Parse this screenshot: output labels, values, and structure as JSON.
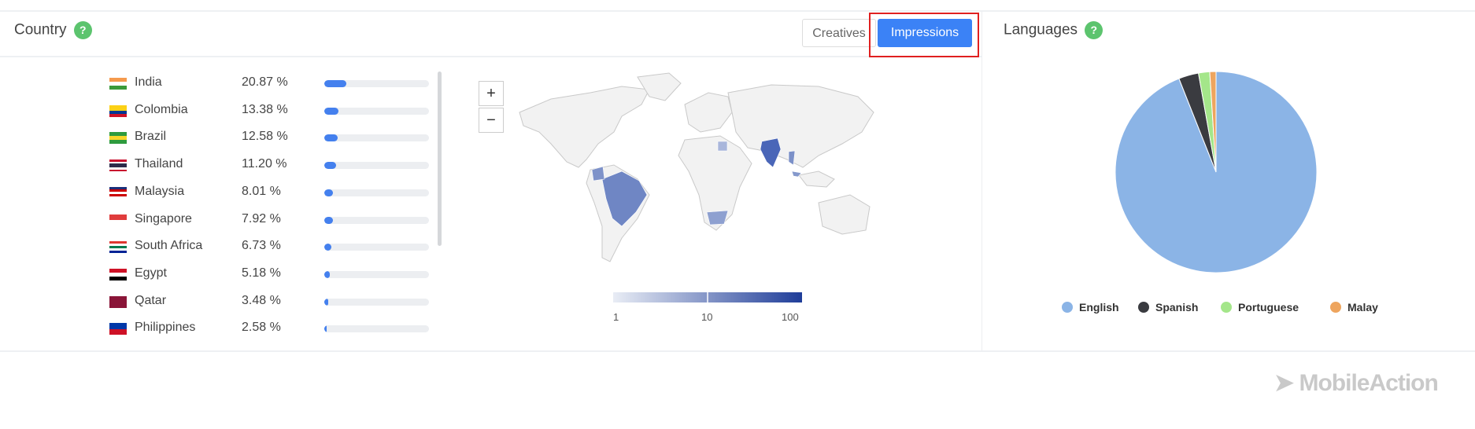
{
  "country_panel": {
    "title": "Country",
    "help_label": "?",
    "toggle": {
      "creatives_label": "Creatives",
      "impressions_label": "Impressions",
      "active": "Impressions"
    },
    "rows": [
      {
        "name": "India",
        "percent": "20.87 %",
        "value": 20.87,
        "flag": [
          "#f59a4d",
          "#ffffff",
          "#3a9a3a"
        ]
      },
      {
        "name": "Colombia",
        "percent": "13.38 %",
        "value": 13.38,
        "flag": [
          "#fcd116",
          "#fcd116",
          "#003893",
          "#ce1126"
        ]
      },
      {
        "name": "Brazil",
        "percent": "12.58 %",
        "value": 12.58,
        "flag": [
          "#2e9b3e",
          "#f7d629",
          "#2e9b3e"
        ]
      },
      {
        "name": "Thailand",
        "percent": "11.20 %",
        "value": 11.2,
        "flag": [
          "#c8102e",
          "#ffffff",
          "#2d2a4a",
          "#2d2a4a",
          "#ffffff",
          "#c8102e"
        ]
      },
      {
        "name": "Malaysia",
        "percent": "8.01 %",
        "value": 8.01,
        "flag": [
          "#1b2f7a",
          "#cc0001",
          "#ffffff",
          "#cc0001",
          "#ffffff"
        ]
      },
      {
        "name": "Singapore",
        "percent": "7.92 %",
        "value": 7.92,
        "flag": [
          "#e03c3c",
          "#ffffff"
        ]
      },
      {
        "name": "South Africa",
        "percent": "6.73 %",
        "value": 6.73,
        "flag": [
          "#de3831",
          "#ffffff",
          "#007a4d",
          "#ffffff",
          "#002395"
        ]
      },
      {
        "name": "Egypt",
        "percent": "5.18 %",
        "value": 5.18,
        "flag": [
          "#ce1126",
          "#ffffff",
          "#000000"
        ]
      },
      {
        "name": "Qatar",
        "percent": "3.48 %",
        "value": 3.48,
        "flag": [
          "#8a1538"
        ]
      },
      {
        "name": "Philippines",
        "percent": "2.58 %",
        "value": 2.58,
        "flag": [
          "#0038a8",
          "#ce1126"
        ]
      }
    ],
    "map": {
      "zoom_in_label": "+",
      "zoom_out_label": "−",
      "scale_labels": [
        "1",
        "10",
        "100"
      ],
      "scale_colors": [
        "#e9edf5",
        "#1f3d99"
      ]
    }
  },
  "languages_panel": {
    "title": "Languages",
    "help_label": "?",
    "chart_data": {
      "type": "pie",
      "legend_position": "bottom",
      "series": [
        {
          "name": "English",
          "value": 94.0,
          "color": "#8bb4e6"
        },
        {
          "name": "Spanish",
          "value": 3.2,
          "color": "#3a3b40"
        },
        {
          "name": "Portuguese",
          "value": 1.8,
          "color": "#a4e68a"
        },
        {
          "name": "Malay",
          "value": 1.0,
          "color": "#eea55e"
        }
      ]
    }
  },
  "footer": {
    "logo_text": "MobileAction"
  },
  "colors": {
    "accent": "#3b82f6",
    "highlight_box": "#e02020",
    "help": "#5cc46e"
  }
}
